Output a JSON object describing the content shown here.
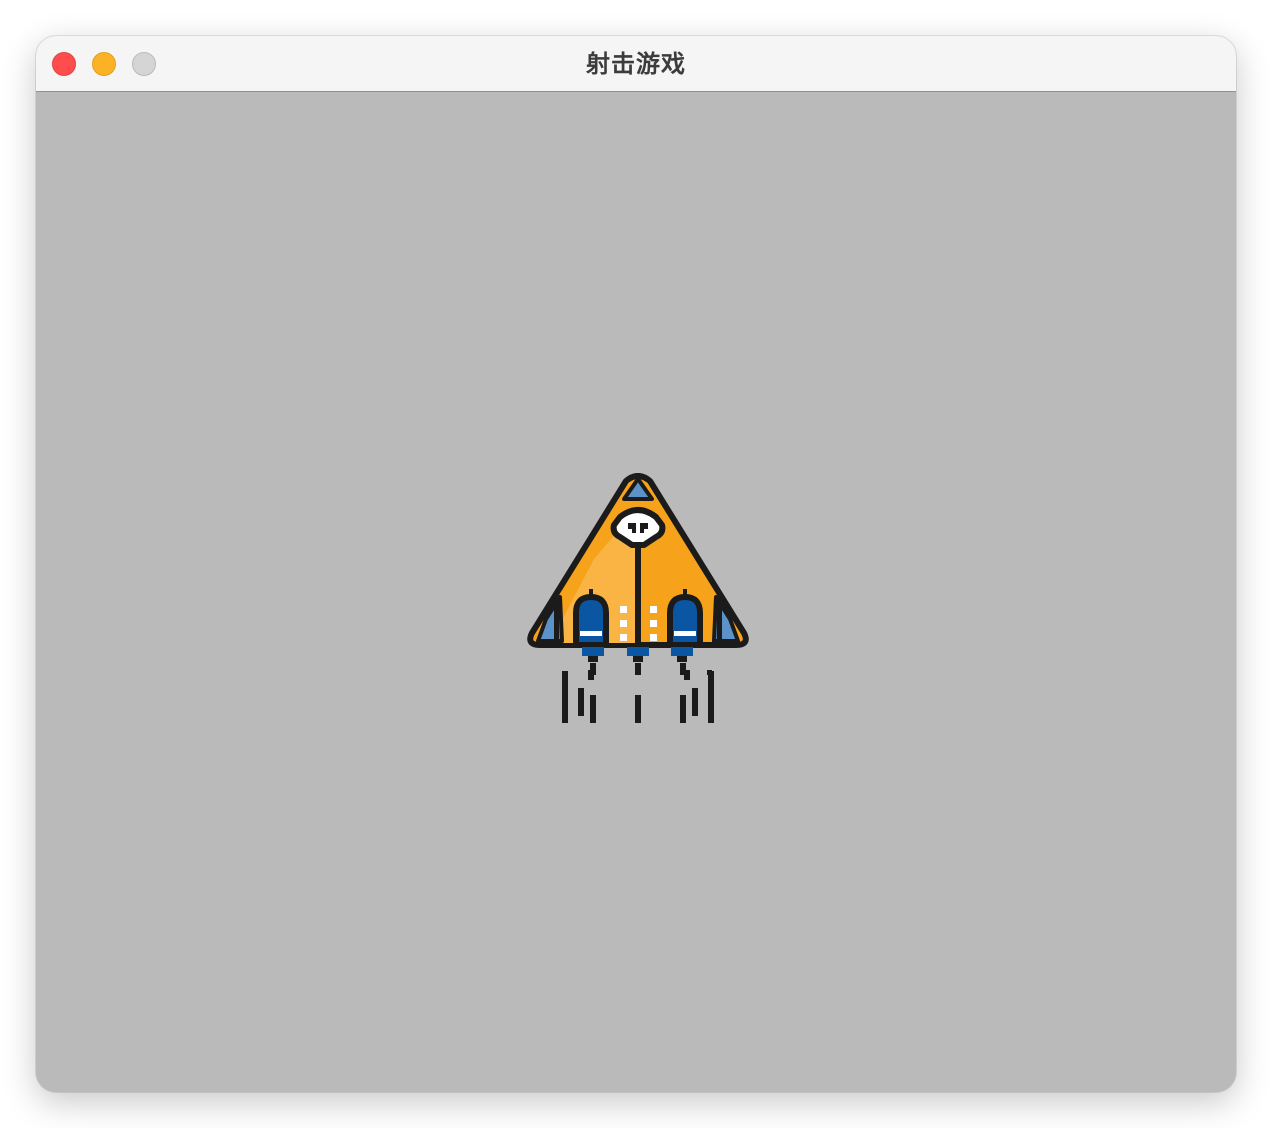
{
  "window": {
    "title": "射击游戏"
  },
  "colors": {
    "canvas_background": "#bababa",
    "titlebar_background": "#f4f5f4",
    "ship_orange": "#f7a21b",
    "ship_orange_light": "#f9b444",
    "ship_blue": "#0b56a3",
    "ship_blue_light": "#5b93c9",
    "outline": "#1b1b1b"
  },
  "icons": {
    "close": "close-button-red-circle",
    "minimize": "minimize-button-yellow-circle",
    "zoom": "zoom-button-gray-circle",
    "player": "pixel-spaceship-icon"
  }
}
